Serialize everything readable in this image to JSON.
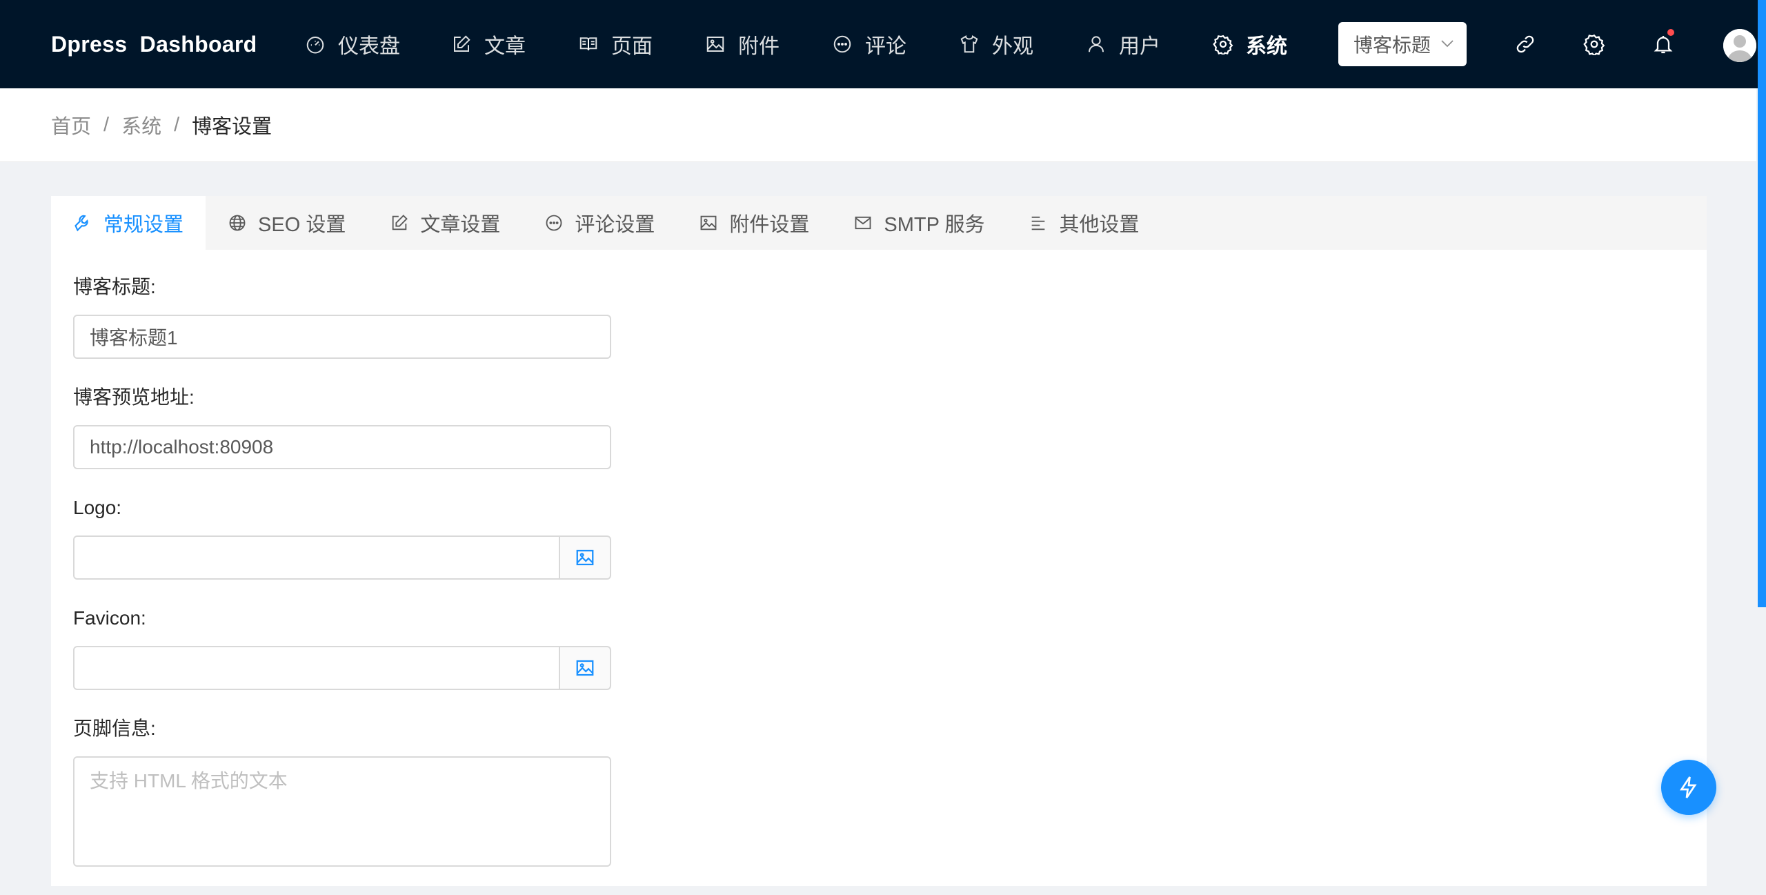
{
  "brand": "Dpress  Dashboard",
  "nav": {
    "items": [
      {
        "label": "仪表盘",
        "icon": "dashboard-icon"
      },
      {
        "label": "文章",
        "icon": "edit-icon"
      },
      {
        "label": "页面",
        "icon": "book-icon"
      },
      {
        "label": "附件",
        "icon": "picture-icon"
      },
      {
        "label": "评论",
        "icon": "comment-icon"
      },
      {
        "label": "外观",
        "icon": "skin-icon"
      },
      {
        "label": "用户",
        "icon": "user-icon"
      },
      {
        "label": "系统",
        "icon": "setting-icon",
        "active": true
      }
    ],
    "blog_select": "博客标题"
  },
  "breadcrumb": {
    "items": [
      "首页",
      "系统",
      "博客设置"
    ],
    "separator": "/"
  },
  "tabs": [
    {
      "label": "常规设置",
      "icon": "tool-icon",
      "active": true
    },
    {
      "label": "SEO 设置",
      "icon": "global-icon"
    },
    {
      "label": "文章设置",
      "icon": "edit-icon"
    },
    {
      "label": "评论设置",
      "icon": "comment-icon"
    },
    {
      "label": "附件设置",
      "icon": "picture-icon"
    },
    {
      "label": "SMTP 服务",
      "icon": "mail-icon"
    },
    {
      "label": "其他设置",
      "icon": "align-left-icon"
    }
  ],
  "form": {
    "blog_title_label": "博客标题:",
    "blog_title_value": "博客标题1",
    "blog_url_label": "博客预览地址:",
    "blog_url_value": "http://localhost:80908",
    "logo_label": "Logo:",
    "logo_value": "",
    "favicon_label": "Favicon:",
    "favicon_value": "",
    "footer_label": "页脚信息:",
    "footer_placeholder": "支持 HTML 格式的文本"
  },
  "colors": {
    "header_bg": "#001529",
    "accent": "#1890ff",
    "page_bg": "#f0f2f5",
    "notification_dot": "#ff4d4f"
  }
}
